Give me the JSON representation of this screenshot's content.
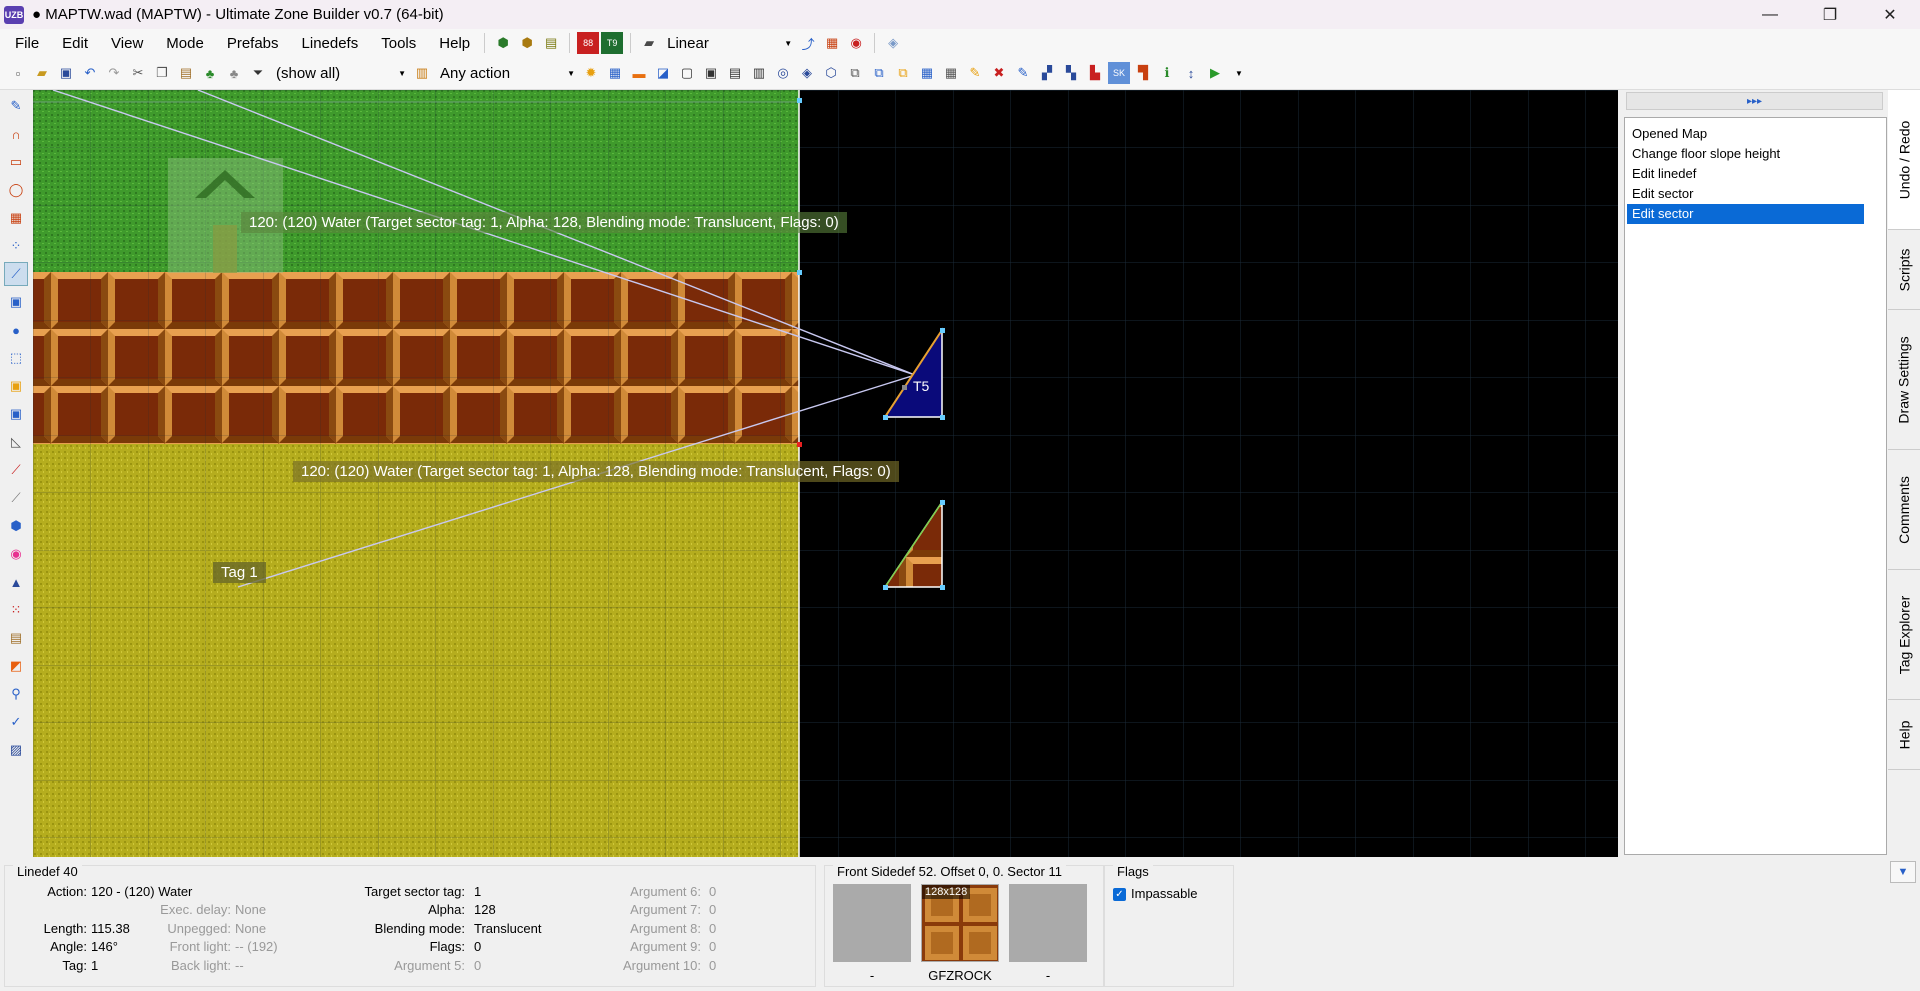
{
  "window": {
    "title": "● MAPTW.wad (MAPTW) - Ultimate Zone Builder v0.7 (64-bit)",
    "app_icon_text": "UZB",
    "minimize": "—",
    "maximize": "❐",
    "close": "✕"
  },
  "menubar": {
    "items": [
      "File",
      "Edit",
      "View",
      "Mode",
      "Prefabs",
      "Linedefs",
      "Tools",
      "Help"
    ],
    "interpolation_mode": "Linear"
  },
  "toolbar": {
    "filter_value": "(show all)",
    "action_value": "Any action"
  },
  "map": {
    "line_label_top": "120: (120) Water (Target sector tag: 1, Alpha: 128, Blending mode: Translucent, Flags: 0)",
    "line_label_bottom": "120: (120) Water (Target sector tag: 1, Alpha: 128, Blending mode: Translucent, Flags: 0)",
    "tag_label": "Tag 1",
    "thing_label": "T5"
  },
  "undo_list": {
    "items": [
      "Opened Map",
      "Change floor slope height",
      "Edit linedef",
      "Edit sector",
      "Edit sector"
    ],
    "selected_index": 4,
    "expand_glyph": "▸▸▸"
  },
  "side_tabs": [
    "Undo / Redo",
    "Scripts",
    "Draw Settings",
    "Comments",
    "Tag Explorer",
    "Help"
  ],
  "info_panel": {
    "title": "Linedef 40",
    "action_label": "Action:",
    "action_value": "120 - (120) Water",
    "exec_delay_label": "Exec. delay:",
    "exec_delay_value": "None",
    "length_label": "Length:",
    "length_value": "115.38",
    "unpegged_label": "Unpegged:",
    "unpegged_value": "None",
    "angle_label": "Angle:",
    "angle_value": "146°",
    "front_light_label": "Front light:",
    "front_light_value": "-- (192)",
    "tag_label": "Tag:",
    "tag_value": "1",
    "back_light_label": "Back light:",
    "back_light_value": "--",
    "args": [
      {
        "label": "Target sector tag:",
        "value": "1"
      },
      {
        "label": "Alpha:",
        "value": "128"
      },
      {
        "label": "Blending mode:",
        "value": "Translucent"
      },
      {
        "label": "Flags:",
        "value": "0"
      },
      {
        "label": "Argument 5:",
        "value": "0"
      }
    ],
    "args2": [
      {
        "label": "Argument 6:",
        "value": "0"
      },
      {
        "label": "Argument 7:",
        "value": "0"
      },
      {
        "label": "Argument 8:",
        "value": "0"
      },
      {
        "label": "Argument 9:",
        "value": "0"
      },
      {
        "label": "Argument 10:",
        "value": "0"
      }
    ]
  },
  "sidedef_panel": {
    "title": "Front Sidedef 52. Offset 0, 0. Sector 11",
    "upper_label": "-",
    "middle_label": "GFZROCK",
    "middle_size": "128x128",
    "lower_label": "-"
  },
  "flags_panel": {
    "title": "Flags",
    "flag_label": "Impassable",
    "check_glyph": "✓"
  },
  "collapse_glyph": "▼",
  "colors": {
    "selection": "#0a6ad6",
    "grass": "#3f9a2c",
    "sand": "#b5ad1e",
    "brick": "#9c5518",
    "sector_blue": "#0a0a7a"
  }
}
